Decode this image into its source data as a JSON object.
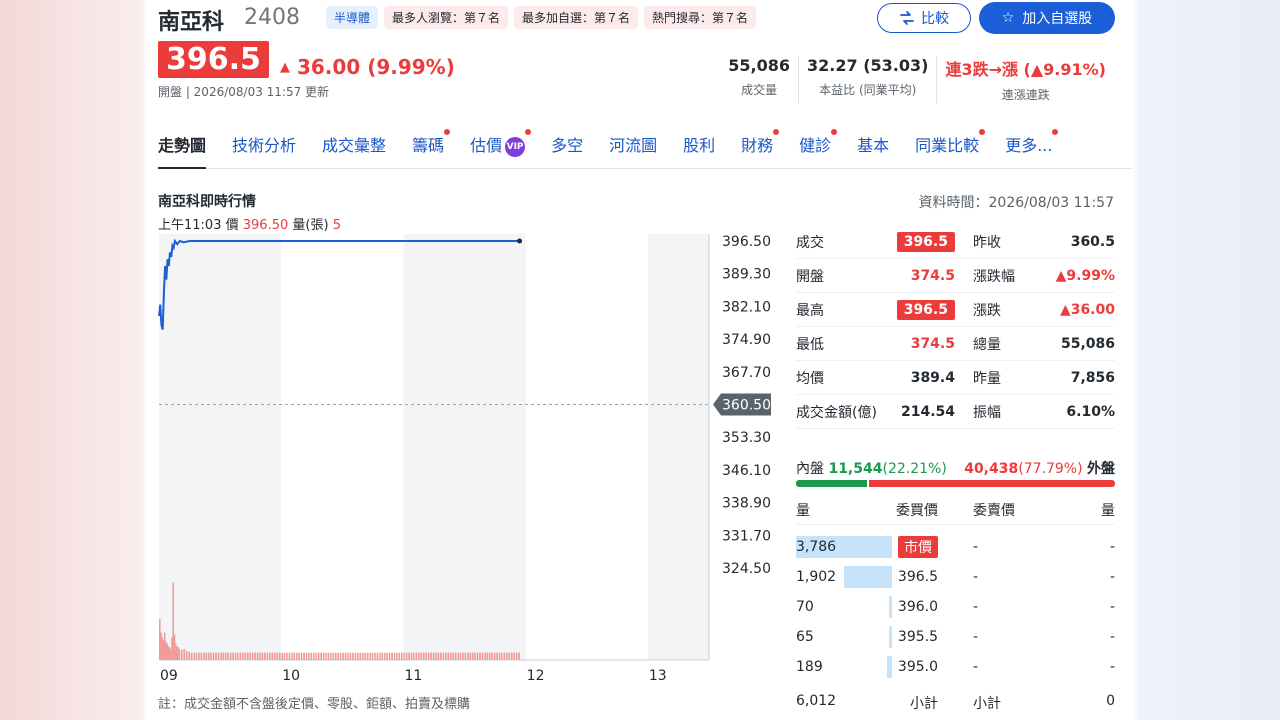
{
  "stock": {
    "name": "南亞科",
    "code": "2408",
    "badges": [
      "半導體",
      "最多人瀏覽：第７名",
      "最多加自選：第７名",
      "熱門搜尋：第７名"
    ],
    "price": "396.5",
    "change": "36.00 (9.99%)",
    "status_time": "開盤 | 2026/08/03 11:57 更新"
  },
  "buttons": {
    "compare": "比較",
    "watchlist": "加入自選股"
  },
  "kpis": [
    {
      "value": "55,086",
      "label": "成交量"
    },
    {
      "value": "32.27 (53.03)",
      "label": "本益比 (同業平均)"
    },
    {
      "value": "連3跌→漲 (▲9.91%)",
      "label": "連漲連跌"
    }
  ],
  "tabs": [
    {
      "label": "走勢圖",
      "dot": false,
      "active": true
    },
    {
      "label": "技術分析",
      "dot": false
    },
    {
      "label": "成交彙整",
      "dot": false
    },
    {
      "label": "籌碼",
      "dot": true
    },
    {
      "label": "估價",
      "dot": true,
      "vip": "VIP"
    },
    {
      "label": "多空",
      "dot": false
    },
    {
      "label": "河流圖",
      "dot": false
    },
    {
      "label": "股利",
      "dot": false
    },
    {
      "label": "財務",
      "dot": true
    },
    {
      "label": "健診",
      "dot": true
    },
    {
      "label": "基本",
      "dot": false
    },
    {
      "label": "同業比較",
      "dot": true
    },
    {
      "label": "更多...",
      "dot": true
    }
  ],
  "section": {
    "title": "南亞科即時行情",
    "data_time": "資料時間：2026/08/03 11:57",
    "tooltip_time": "上午11:03",
    "tooltip_price_label": "價",
    "tooltip_price": "396.50",
    "tooltip_vol_label": "量(張)",
    "tooltip_vol": "5",
    "note": "註：成交金額不含盤後定價、零股、鉅額、拍賣及標購"
  },
  "chart_data": {
    "type": "line",
    "title": "",
    "y_ticks": [
      "396.50",
      "389.30",
      "382.10",
      "374.90",
      "367.70",
      "360.50",
      "353.30",
      "346.10",
      "338.90",
      "331.70",
      "324.50"
    ],
    "ylim": [
      324.5,
      396.5
    ],
    "reference_price": 360.5,
    "reference_label": "360.50",
    "x_ticks": [
      "09",
      "10",
      "11",
      "12",
      "13"
    ],
    "x_tick_hours": [
      9,
      10,
      11,
      12,
      13
    ],
    "xlim_hours": [
      9,
      13.5
    ],
    "price_series": {
      "t": [
        9.0,
        9.01,
        9.02,
        9.03,
        9.04,
        9.05,
        9.06,
        9.07,
        9.08,
        9.09,
        9.1,
        9.11,
        9.12,
        9.13,
        9.15,
        9.17,
        9.2,
        9.25,
        9.3,
        9.4,
        9.5,
        10.0,
        10.5,
        11.0,
        11.5,
        11.95
      ],
      "v": [
        380.0,
        382.5,
        378.0,
        377.0,
        385.0,
        391.0,
        388.0,
        392.5,
        391.0,
        394.0,
        393.0,
        395.5,
        395.0,
        396.5,
        395.8,
        396.5,
        396.2,
        396.5,
        396.5,
        396.5,
        396.5,
        396.5,
        396.5,
        396.5,
        396.5,
        396.5
      ]
    },
    "volume_series": {
      "t": [
        9.0,
        9.01,
        9.02,
        9.03,
        9.04,
        9.05,
        9.06,
        9.07,
        9.08,
        9.09,
        9.1,
        9.11,
        9.12,
        9.13,
        9.14,
        9.15,
        9.16,
        9.18,
        9.2,
        9.22,
        9.24
      ],
      "v": [
        45,
        30,
        25,
        22,
        30,
        20,
        18,
        15,
        14,
        12,
        25,
        85,
        28,
        18,
        15,
        14,
        12,
        11,
        12,
        10,
        9
      ],
      "baseline": 8,
      "baseline_until": 11.95,
      "max": 90
    }
  },
  "quote": {
    "rows": [
      {
        "l1": "成交",
        "v1": "396.5",
        "s1": "box",
        "l2": "昨收",
        "v2": "360.5",
        "s2": ""
      },
      {
        "l1": "開盤",
        "v1": "374.5",
        "s1": "red",
        "l2": "漲跌幅",
        "v2": "▲9.99%",
        "s2": "red"
      },
      {
        "l1": "最高",
        "v1": "396.5",
        "s1": "box",
        "l2": "漲跌",
        "v2": "▲36.00",
        "s2": "red"
      },
      {
        "l1": "最低",
        "v1": "374.5",
        "s1": "red",
        "l2": "總量",
        "v2": "55,086",
        "s2": ""
      },
      {
        "l1": "均價",
        "v1": "389.4",
        "s1": "",
        "l2": "昨量",
        "v2": "7,856",
        "s2": ""
      },
      {
        "l1": "成交金額(億)",
        "v1": "214.54",
        "s1": "",
        "l2": "振幅",
        "v2": "6.10%",
        "s2": ""
      }
    ]
  },
  "inout": {
    "in_label": "內盤",
    "in_value": "11,544",
    "in_pct_text": "(22.21%)",
    "in_pct": 22.21,
    "out_value": "40,438",
    "out_pct_text": "(77.79%)",
    "out_label": "外盤"
  },
  "orderbook": {
    "head_buy_vol": "量",
    "head_buy_price": "委買價",
    "head_sell_price": "委賣價",
    "head_sell_vol": "量",
    "rows": [
      {
        "buy_vol": "3,786",
        "buy_price": "市價",
        "market": true,
        "fill": 1.0,
        "sell_price": "-",
        "sell_vol": "-"
      },
      {
        "buy_vol": "1,902",
        "buy_price": "396.5",
        "market": false,
        "fill": 0.5,
        "sell_price": "-",
        "sell_vol": "-"
      },
      {
        "buy_vol": "70",
        "buy_price": "396.0",
        "market": false,
        "fill": 0.02,
        "sell_price": "-",
        "sell_vol": "-"
      },
      {
        "buy_vol": "65",
        "buy_price": "395.5",
        "market": false,
        "fill": 0.02,
        "sell_price": "-",
        "sell_vol": "-"
      },
      {
        "buy_vol": "189",
        "buy_price": "395.0",
        "market": false,
        "fill": 0.05,
        "sell_price": "-",
        "sell_vol": "-"
      }
    ],
    "total_buy": "6,012",
    "total_label": "小計",
    "total_sell": "0"
  },
  "colors": {
    "up": "#eb3b3b",
    "down": "#1a9a4a",
    "line": "#1a5fd8",
    "accent": "#1a57c9"
  }
}
